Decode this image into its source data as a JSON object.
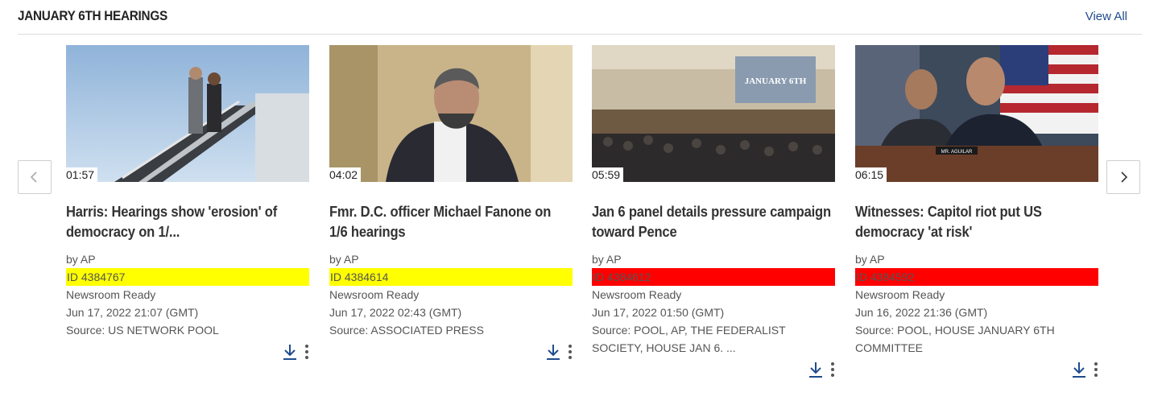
{
  "section": {
    "title": "JANUARY 6TH HEARINGS",
    "view_all": "View All"
  },
  "nav": {
    "prev_icon": "chevron-left-icon",
    "next_icon": "chevron-right-icon"
  },
  "cards": [
    {
      "duration": "01:57",
      "title": "Harris: Hearings show 'erosion' of democracy on 1/...",
      "byline": "by AP",
      "id": "ID 4384767",
      "id_color": "#ffff00",
      "status": "Newsroom Ready",
      "date": "Jun 17, 2022 21:07 (GMT)",
      "source": "Source: US NETWORK POOL"
    },
    {
      "duration": "04:02",
      "title": "Fmr. D.C. officer Michael Fanone on 1/6 hearings",
      "byline": "by AP",
      "id": "ID 4384614",
      "id_color": "#ffff00",
      "status": "Newsroom Ready",
      "date": "Jun 17, 2022 02:43 (GMT)",
      "source": "Source: ASSOCIATED PRESS"
    },
    {
      "duration": "05:59",
      "title": "Jan 6 panel details pressure campaign toward Pence",
      "byline": "by AP",
      "id": "ID 4384612",
      "id_color": "#ff0000",
      "status": "Newsroom Ready",
      "date": "Jun 17, 2022 01:50 (GMT)",
      "source": "Source: POOL, AP, THE FEDERALIST SOCIETY, HOUSE JAN 6. ..."
    },
    {
      "duration": "06:15",
      "title": "Witnesses: Capitol riot put US democracy 'at risk'",
      "byline": "by AP",
      "id": "ID 4384592",
      "id_color": "#ff0000",
      "status": "Newsroom Ready",
      "date": "Jun 16, 2022 21:36 (GMT)",
      "source": "Source: POOL, HOUSE JANUARY 6TH COMMITTEE"
    }
  ],
  "thumb_text": {
    "screen_line1": "JANUARY 6TH",
    "nameplate": "MR. AGUILAR"
  },
  "colors": {
    "accent": "#1f4b8e",
    "highlight_yellow": "#ffff00",
    "highlight_red": "#ff0000"
  }
}
